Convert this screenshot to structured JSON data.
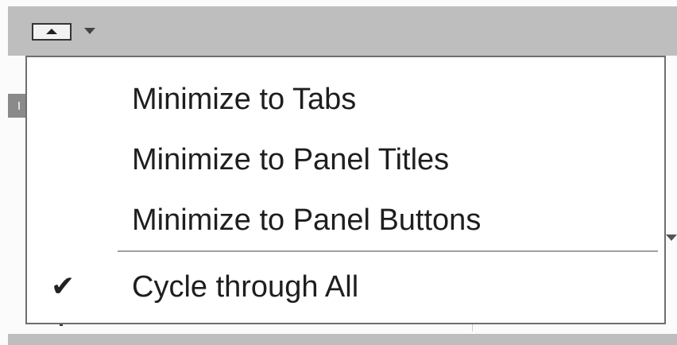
{
  "toolbar": {
    "toggle_icon": "panel-toggle-icon",
    "dropdown_icon": "dropdown-arrow-icon"
  },
  "menu": {
    "items": [
      {
        "label": "Minimize to Tabs",
        "checked": false
      },
      {
        "label": "Minimize to Panel Titles",
        "checked": false
      },
      {
        "label": "Minimize to Panel Buttons",
        "checked": false
      },
      {
        "label": "Cycle through All",
        "checked": true
      }
    ],
    "check_glyph": "✔"
  }
}
